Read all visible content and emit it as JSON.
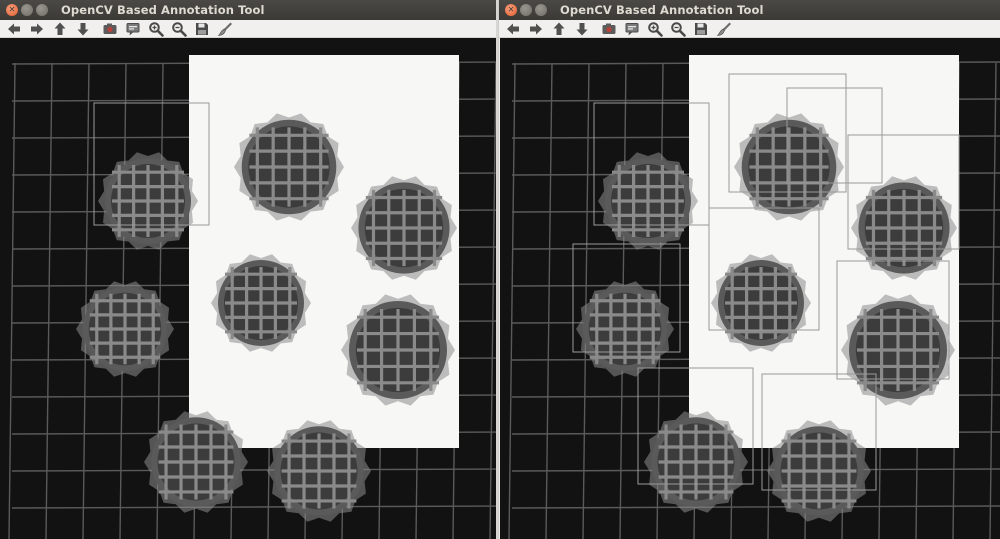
{
  "windows": [
    {
      "title": "OpenCV Based Annotation Tool",
      "annotations_visible": "selection-only",
      "toolbar": [
        "arrow-left-icon",
        "arrow-right-icon",
        "arrow-up-icon",
        "arrow-down-icon",
        "camera-icon",
        "comment-icon",
        "zoom-in-icon",
        "zoom-out-icon",
        "save-icon",
        "brush-icon"
      ]
    },
    {
      "title": "OpenCV Based Annotation Tool",
      "annotations_visible": "all-boxes",
      "toolbar": [
        "arrow-left-icon",
        "arrow-right-icon",
        "arrow-up-icon",
        "arrow-down-icon",
        "camera-icon",
        "comment-icon",
        "zoom-in-icon",
        "zoom-out-icon",
        "save-icon",
        "brush-icon"
      ]
    }
  ],
  "scene": {
    "background_color": "#121212",
    "grid_color": "#5a5a5a",
    "paper_color": "#f7f7f5",
    "waffle_color": "#5a5a5a",
    "box_color": "#9a9a9a",
    "object_count": 9
  }
}
